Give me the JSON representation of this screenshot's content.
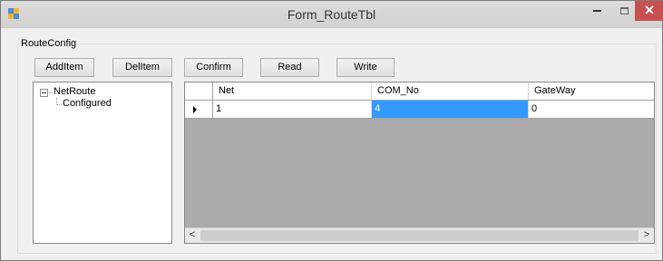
{
  "window": {
    "title": "Form_RouteTbl",
    "minimize_glyph": "",
    "close_glyph": "✕"
  },
  "group": {
    "label": "RouteConfig"
  },
  "toolbar": {
    "add_label": "AddItem",
    "del_label": "DelItem",
    "confirm_label": "Confirm",
    "read_label": "Read",
    "write_label": "Write"
  },
  "tree": {
    "root": "NetRoute",
    "children": [
      "Configured"
    ],
    "expanded": true
  },
  "grid": {
    "columns": [
      "Net",
      "COM_No",
      "GateWay"
    ],
    "rows": [
      {
        "net": "1",
        "com_no": "4",
        "gateway": "0"
      }
    ],
    "selected_cell": "COM_No",
    "selection_color": "#3399ff"
  },
  "scrollbar": {
    "left_arrow": "<",
    "right_arrow": ">"
  },
  "colors": {
    "close_button": "#c75050",
    "grid_background": "#ababab",
    "window_background": "#f0f0f0"
  }
}
